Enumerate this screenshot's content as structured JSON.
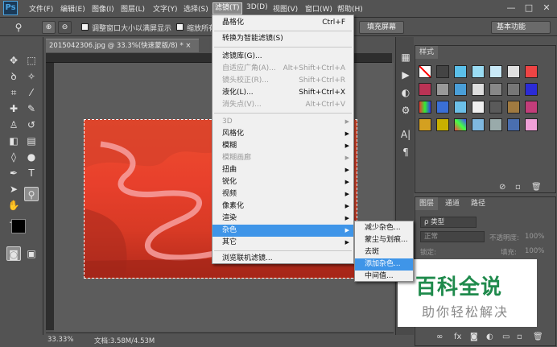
{
  "app": {
    "logo": "Ps"
  },
  "menubar": {
    "items": [
      "文件(F)",
      "编辑(E)",
      "图像(I)",
      "图层(L)",
      "文字(Y)",
      "选择(S)",
      "滤镜(T)",
      "3D(D)",
      "视图(V)",
      "窗口(W)",
      "帮助(H)"
    ],
    "active_index": 6,
    "window_controls": [
      "—",
      "□",
      "✕"
    ]
  },
  "options_bar": {
    "checkbox1_label": "调整窗口大小以满屏显示",
    "checkbox2_label": "缩放所有",
    "fill_screen_label": "填充屏幕",
    "workspace_label": "基本功能"
  },
  "document": {
    "tab_title": "2015042306.jpg @ 33.3%(快速蒙版/8) *",
    "tab_close": "×",
    "zoom": "33.33%",
    "doc_info": "文档:3.58M/4.53M"
  },
  "filter_menu": {
    "items": [
      {
        "label": "晶格化",
        "shortcut": "Ctrl+F",
        "state": "normal"
      },
      {
        "label": "转换为智能滤镜(S)",
        "shortcut": "",
        "state": "normal"
      },
      {
        "label": "滤镜库(G)...",
        "shortcut": "",
        "state": "normal"
      },
      {
        "label": "自适应广角(A)...",
        "shortcut": "Alt+Shift+Ctrl+A",
        "state": "disabled"
      },
      {
        "label": "镜头校正(R)...",
        "shortcut": "Shift+Ctrl+R",
        "state": "disabled"
      },
      {
        "label": "液化(L)...",
        "shortcut": "Shift+Ctrl+X",
        "state": "normal"
      },
      {
        "label": "消失点(V)...",
        "shortcut": "Alt+Ctrl+V",
        "state": "disabled"
      },
      {
        "label": "3D",
        "submenu": true,
        "state": "disabled"
      },
      {
        "label": "风格化",
        "submenu": true,
        "state": "normal"
      },
      {
        "label": "模糊",
        "submenu": true,
        "state": "normal"
      },
      {
        "label": "模糊画廊",
        "submenu": true,
        "state": "disabled"
      },
      {
        "label": "扭曲",
        "submenu": true,
        "state": "normal"
      },
      {
        "label": "锐化",
        "submenu": true,
        "state": "normal"
      },
      {
        "label": "视频",
        "submenu": true,
        "state": "normal"
      },
      {
        "label": "像素化",
        "submenu": true,
        "state": "normal"
      },
      {
        "label": "渲染",
        "submenu": true,
        "state": "normal"
      },
      {
        "label": "杂色",
        "submenu": true,
        "state": "highlighted"
      },
      {
        "label": "其它",
        "submenu": true,
        "state": "normal"
      },
      {
        "label": "浏览联机滤镜...",
        "shortcut": "",
        "state": "normal"
      }
    ],
    "submenu_arrow": "▶"
  },
  "noise_submenu": {
    "items": [
      "减少杂色...",
      "蒙尘与划痕...",
      "去斑",
      "添加杂色...",
      "中间值..."
    ],
    "highlighted_index": 3
  },
  "swatches_panel": {
    "tab": "样式"
  },
  "layers_panel": {
    "tabs": [
      "图层",
      "通道",
      "路径"
    ],
    "kind_label": "ρ 类型",
    "blend_mode": "正常",
    "opacity_label": "不透明度:",
    "opacity_value": "100%",
    "lock_label": "锁定:",
    "fill_label": "填充:",
    "fill_value": "100%"
  },
  "watermark": {
    "title": "百科全说",
    "subtitle": "助你轻松解决"
  },
  "colors": {
    "accent": "#3f95e8",
    "menu_bg": "#f0f0f0",
    "ui_bg": "#535353",
    "watermark_green": "#1f8a4c"
  }
}
